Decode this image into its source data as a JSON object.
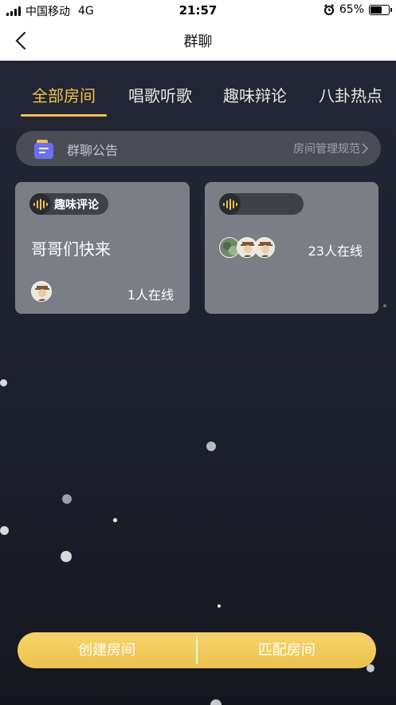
{
  "status_bar": {
    "carrier": "中国移动",
    "network": "4G",
    "time": "21:57",
    "battery": "65%"
  },
  "nav": {
    "title": "群聊"
  },
  "tabs": [
    {
      "label": "全部房间",
      "active": true
    },
    {
      "label": "唱歌听歌",
      "active": false
    },
    {
      "label": "趣味辩论",
      "active": false
    },
    {
      "label": "八卦热点",
      "active": false
    }
  ],
  "notice": {
    "title": "群聊公告",
    "link": "房间管理规范"
  },
  "rooms": [
    {
      "tag": "趣味评论",
      "title": "哥哥们快来",
      "online": "1人在线"
    },
    {
      "tag": "",
      "title": "",
      "online": "23人在线"
    }
  ],
  "actions": {
    "create": "创建房间",
    "match": "匹配房间"
  },
  "colors": {
    "accent": "#f2c04c",
    "background": "#1f2230",
    "card": "#7b7e85"
  }
}
